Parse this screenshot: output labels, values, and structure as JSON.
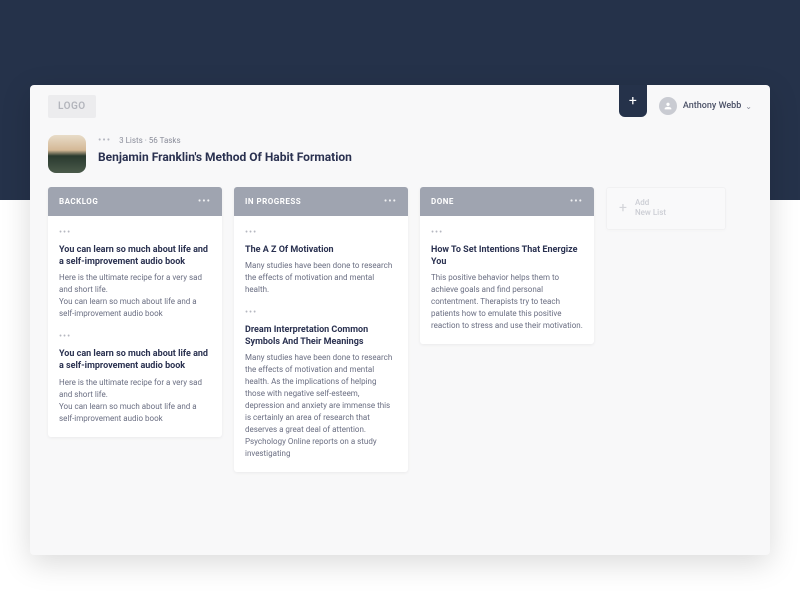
{
  "logo": "LOGO",
  "user": {
    "name": "Anthony Webb"
  },
  "board": {
    "stats": "3 Lists · 56 Tasks",
    "title": "Benjamin Franklin's Method Of Habit Formation"
  },
  "addList": "Add\nNew List",
  "lists": [
    {
      "title": "BACKLOG",
      "cards": [
        {
          "title": "You can learn so much about life and a self-improvement audio book",
          "text": "Here is the ultimate recipe for a very sad and short life.\nYou can learn so much about life and a self-improvement audio book"
        },
        {
          "title": "You can learn so much about life and a self-improvement audio book",
          "text": "Here is the ultimate recipe for a very sad and short life.\nYou can learn so much about life and a self-improvement audio book"
        }
      ]
    },
    {
      "title": "IN PROGRESS",
      "cards": [
        {
          "title": "The A Z Of Motivation",
          "text": "Many studies have been done to research the effects of motivation and mental health."
        },
        {
          "title": "Dream Interpretation Common Symbols And Their Meanings",
          "text": "Many studies have been done to research the effects of motivation and mental health. As the implications of helping those with negative self-esteem, depression and anxiety are immense this is certainly an area of research that deserves a great deal of attention. Psychology Online reports on a study investigating"
        }
      ]
    },
    {
      "title": "DONE",
      "cards": [
        {
          "title": "How To Set Intentions That Energize You",
          "text": "This positive behavior helps them to achieve goals and find personal contentment. Therapists try to teach patients how to emulate this positive reaction to stress and use their motivation."
        }
      ]
    }
  ]
}
